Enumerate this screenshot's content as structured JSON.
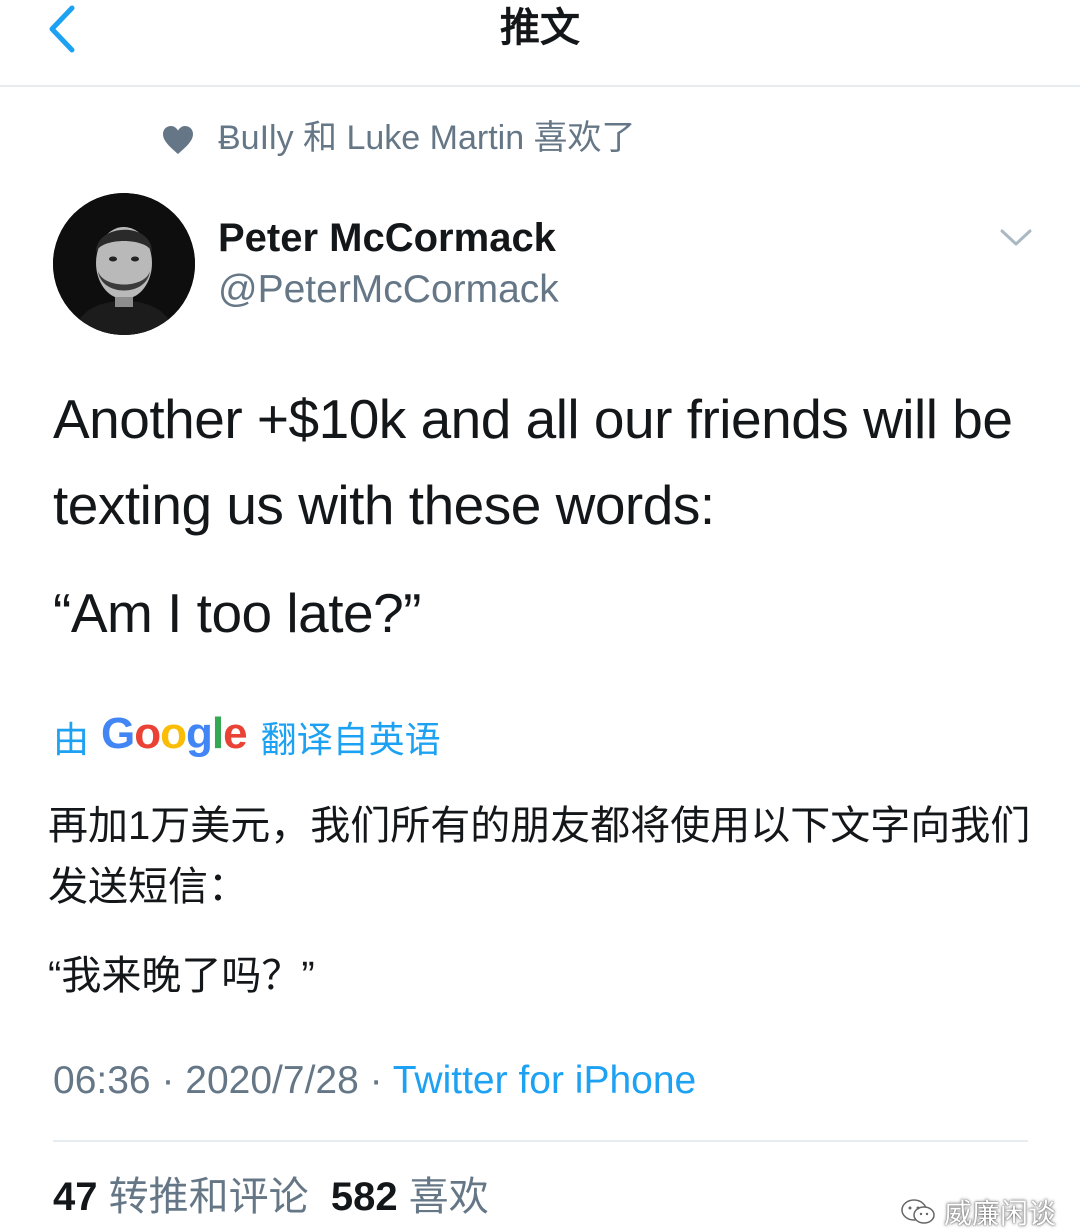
{
  "header": {
    "title": "推文",
    "back_icon": "chevron-left-icon"
  },
  "social_context": {
    "icon": "heart-icon",
    "text": "ɃuIly 和 Luke Martin 喜欢了"
  },
  "author": {
    "name": "Peter McCormack",
    "handle": "@PeterMcCormack",
    "menu_icon": "chevron-down-icon"
  },
  "tweet": {
    "line1": "Another +$10k and all our friends will be texting us with these words:",
    "line2": "“Am I too late?”"
  },
  "translation": {
    "prefix": "由",
    "brand": [
      "G",
      "o",
      "o",
      "g",
      "l",
      "e"
    ],
    "suffix": "翻译自英语",
    "text1": "再加1万美元，我们所有的朋友都将使用以下文字向我们发送短信：",
    "text2": "“我来晚了吗？”"
  },
  "meta": {
    "time": "06:36",
    "sep1": " · ",
    "date": "2020/7/28",
    "sep2": " · ",
    "source": "Twitter for iPhone"
  },
  "stats": {
    "retweets_count": "47",
    "retweets_label": "转推和评论",
    "likes_count": "582",
    "likes_label": "喜欢"
  },
  "watermark": {
    "text": "威廉闲谈",
    "icon": "wechat-icon"
  },
  "colors": {
    "accent": "#1da1f2",
    "secondary_text": "#657786",
    "primary_text": "#14171a",
    "divider": "#e6ecf0"
  }
}
